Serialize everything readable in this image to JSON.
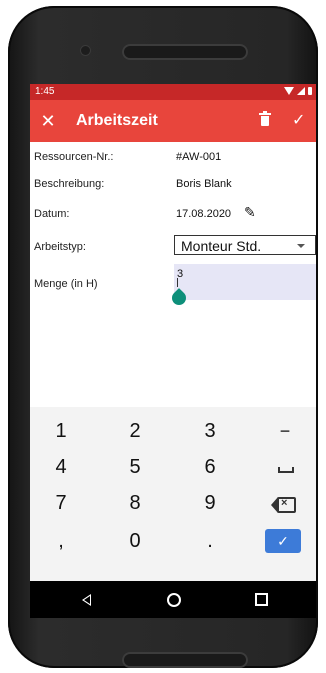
{
  "statusbar": {
    "time": "1:45"
  },
  "appbar": {
    "title": "Arbeitszeit",
    "close_icon": "close-icon",
    "delete_icon": "trash-icon",
    "confirm_icon": "check-icon"
  },
  "form": {
    "resource_label": "Ressourcen-Nr.:",
    "resource_value": "#AW-001",
    "description_label": "Beschreibung:",
    "description_value": "Boris Blank",
    "date_label": "Datum:",
    "date_value": "17.08.2020",
    "worktype_label": "Arbeitstyp:",
    "worktype_value": "Monteur Std.",
    "quantity_label": "Menge (in H)",
    "quantity_value": "3"
  },
  "keyboard": {
    "row1": [
      "1",
      "2",
      "3",
      "−"
    ],
    "row2": [
      "4",
      "5",
      "6"
    ],
    "row3": [
      "7",
      "8",
      "9"
    ],
    "row4": [
      ",",
      "0",
      "."
    ],
    "enter_label": "✓"
  },
  "colors": {
    "statusbar": "#c62828",
    "appbar": "#e8453c",
    "input_bg": "#e6e6f6",
    "cursor_handle": "#0d8f7a",
    "enter_key": "#3d7bd8"
  }
}
